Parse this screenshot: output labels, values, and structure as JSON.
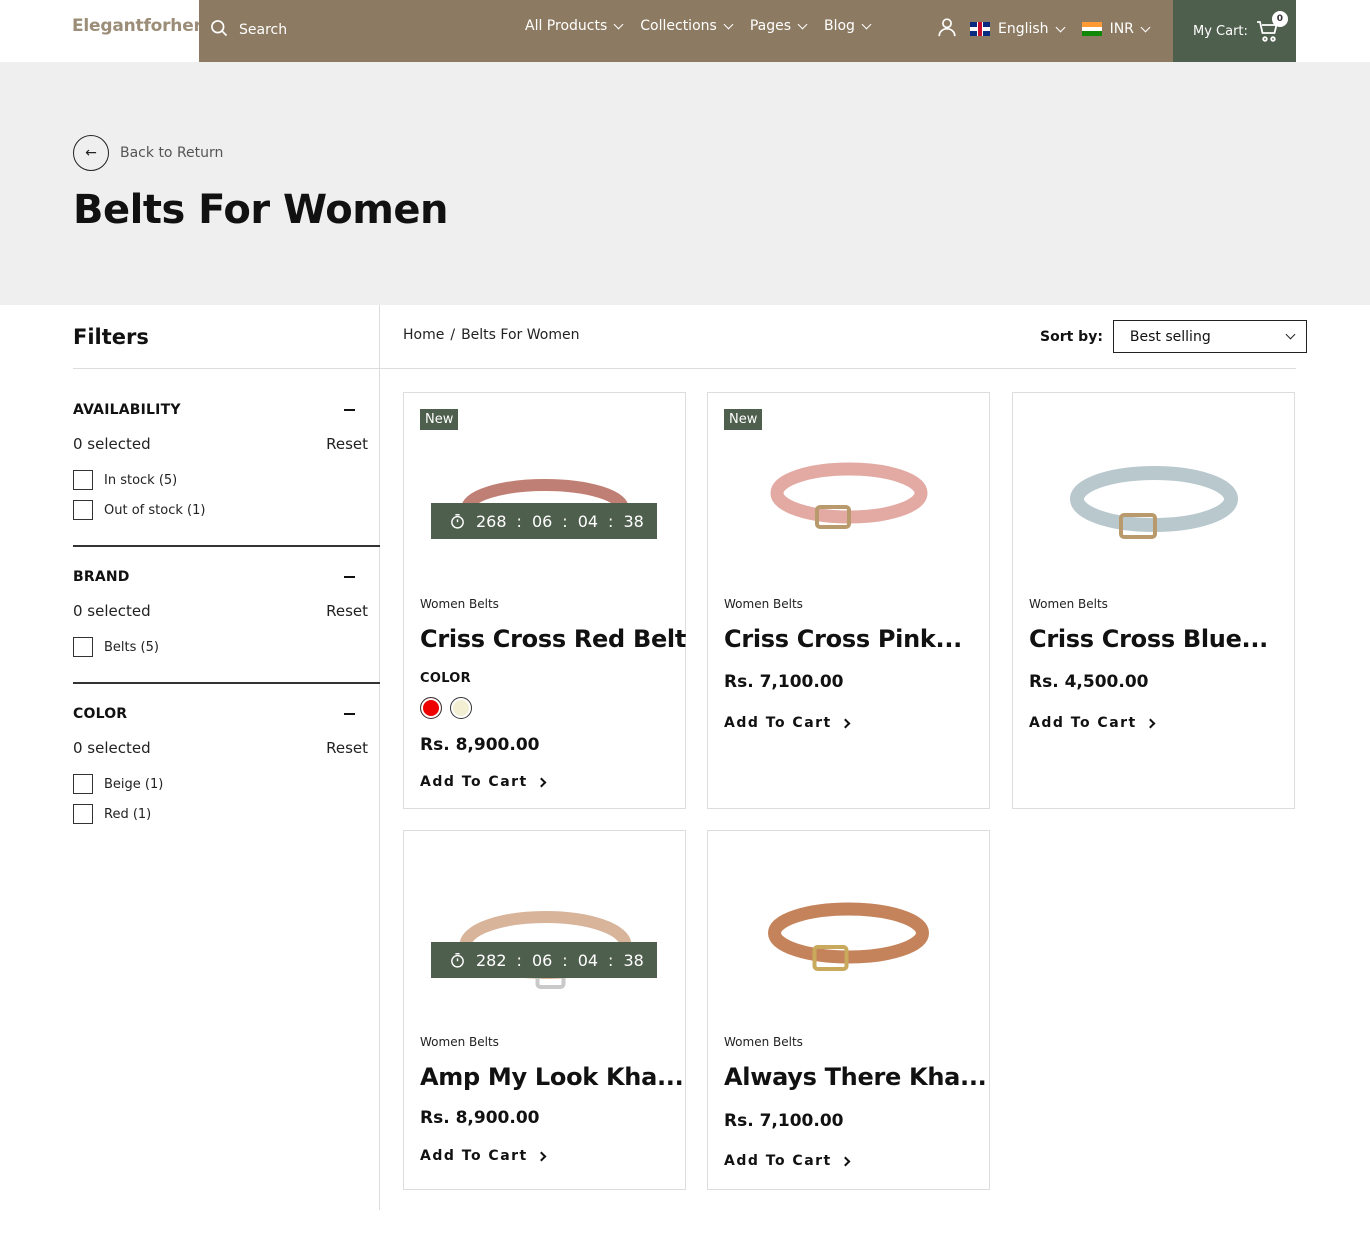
{
  "header": {
    "logo": "Elegantforher",
    "search_placeholder": "Search",
    "nav": [
      "All Products",
      "Collections",
      "Pages",
      "Blog"
    ],
    "language": "English",
    "currency": "INR",
    "cart_label": "My Cart:",
    "cart_count": "0",
    "icons": {
      "search": "search-icon",
      "user": "user-icon",
      "cart": "cart-icon",
      "lang_flag": "uk-flag-icon",
      "currency_flag": "india-flag-icon"
    },
    "colors": {
      "topbar": "#8c7b62",
      "cart": "#4f5f4d"
    }
  },
  "hero": {
    "back_label": "Back to Return",
    "title": "Belts For Women"
  },
  "filters": {
    "title": "Filters",
    "sections": [
      {
        "name": "AVAILABILITY",
        "selected": "0 selected",
        "reset": "Reset",
        "options": [
          "In stock (5)",
          "Out of stock (1)"
        ]
      },
      {
        "name": "BRAND",
        "selected": "0 selected",
        "reset": "Reset",
        "options": [
          "Belts (5)"
        ]
      },
      {
        "name": "COLOR",
        "selected": "0 selected",
        "reset": "Reset",
        "options": [
          "Beige (1)",
          "Red (1)"
        ]
      }
    ]
  },
  "breadcrumb": {
    "home": "Home",
    "separator": "/",
    "current": "Belts For Women"
  },
  "sort": {
    "label": "Sort by:",
    "value": "Best selling"
  },
  "products": [
    {
      "badge": "New",
      "timer": [
        "268",
        ":",
        "06",
        ":",
        "04",
        ":",
        "38"
      ],
      "vendor": "Women Belts",
      "name": "Criss Cross Red Belt",
      "color_label": "COLOR",
      "swatches": [
        "#ee0000",
        "#f2efd2"
      ],
      "price": "Rs. 8,900.00",
      "cta": "Add To Cart",
      "belt_color": "#c07f74"
    },
    {
      "badge": "New",
      "vendor": "Women Belts",
      "name": "Criss Cross Pink...",
      "price": "Rs. 7,100.00",
      "cta": "Add To Cart",
      "belt_color": "#e2aaa3"
    },
    {
      "vendor": "Women Belts",
      "name": "Criss Cross Blue...",
      "price": "Rs. 4,500.00",
      "cta": "Add To Cart",
      "belt_color": "#b8c8cd"
    },
    {
      "timer": [
        "282",
        ":",
        "06",
        ":",
        "04",
        ":",
        "38"
      ],
      "vendor": "Women Belts",
      "name": "Amp My Look Kha...",
      "price": "Rs. 8,900.00",
      "cta": "Add To Cart",
      "belt_color": "#d8b49a"
    },
    {
      "vendor": "Women Belts",
      "name": "Always There Kha...",
      "price": "Rs. 7,100.00",
      "cta": "Add To Cart",
      "belt_color": "#c4835a"
    }
  ]
}
